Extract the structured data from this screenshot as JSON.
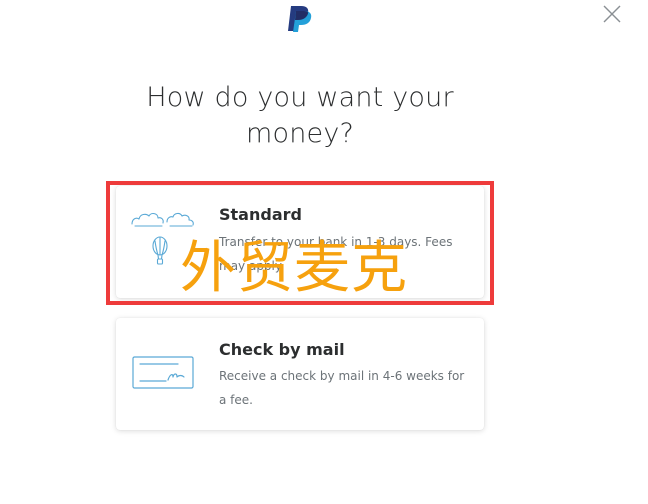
{
  "header": {
    "logo_icon": "paypal-logo-icon",
    "close_icon": "close-icon"
  },
  "heading": "How do you want your money?",
  "options": [
    {
      "title": "Standard",
      "description": "Transfer to your bank in 1-3 days. Fees may apply.",
      "icon": "clouds-balloon-icon"
    },
    {
      "title": "Check by mail",
      "description": "Receive a check by mail in 4-6 weeks for a fee.",
      "icon": "check-icon"
    }
  ],
  "overlay": {
    "watermark_text": "外贸麦克",
    "highlight_color": "#ee3b3b",
    "watermark_color": "#f6a10e"
  },
  "colors": {
    "brand_dark_blue": "#253b80",
    "brand_light_blue": "#179bd7",
    "icon_blue": "#5aa9d6",
    "text_primary": "#2c2e2f",
    "text_secondary": "#6c7378"
  }
}
